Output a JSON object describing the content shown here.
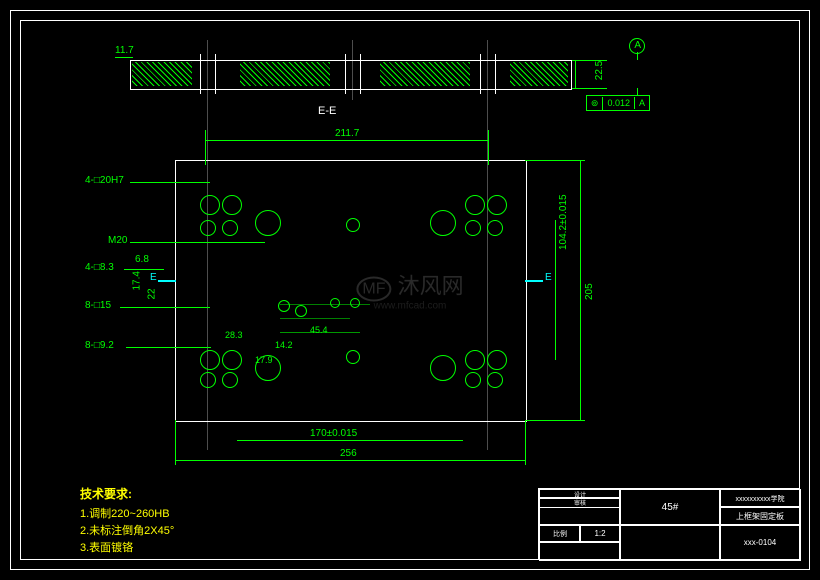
{
  "section_view": {
    "label": "E-E",
    "dim_left": "11.7",
    "dim_right": "22.5",
    "datum_ref": "A",
    "fcf_symbol": "⊚",
    "fcf_tol": "0.012",
    "fcf_datum": "A"
  },
  "plan_view": {
    "top_dim": "211.7",
    "bottom_inner_dim": "170±0.015",
    "bottom_outer_dim": "256",
    "right_inner_dim": "104.2±0.015",
    "right_outer_dim": "205",
    "section_marks": "E"
  },
  "callouts": {
    "c1": "4-□20H7",
    "c2": "M20",
    "c3": "4-□8.3",
    "c4": "8-□15",
    "c5": "8-□9.2",
    "d_68": "6.8",
    "d_174": "17.4",
    "d_22": "22",
    "d_283": "28.3",
    "d_142": "14.2",
    "d_179": "17.9",
    "d_454": "45.4"
  },
  "tech_req": {
    "title": "技术要求:",
    "line1": "1.调制220~260HB",
    "line2": "2.未标注倒角2X45°",
    "line3": "3.表面镀铬"
  },
  "title_block": {
    "material": "45#",
    "part_name": "上框架固定板",
    "scale_label": "比例",
    "scale": "1:2",
    "sheet": "xxx-0104",
    "company": "xxxxxxxxxx学院",
    "design_label": "设计",
    "check_label": "审核"
  },
  "watermark": "沐风网"
}
